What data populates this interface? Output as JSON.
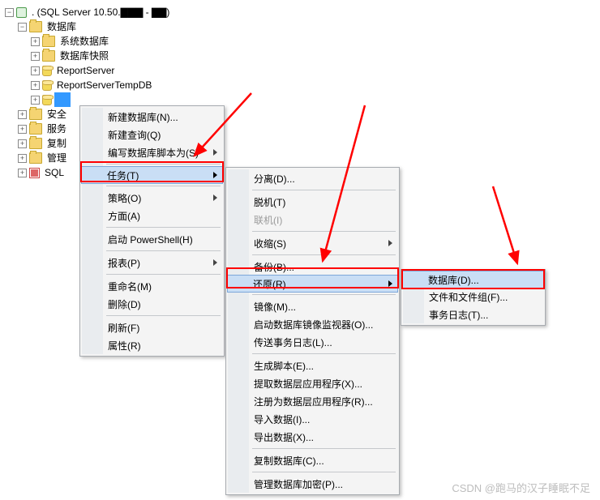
{
  "tree": {
    "server": ". (SQL Server 10.50.▇▇▇ - ▇▇)",
    "databases": "数据库",
    "items": [
      {
        "label": "系统数据库",
        "icon": "folder"
      },
      {
        "label": "数据库快照",
        "icon": "folder"
      },
      {
        "label": "ReportServer",
        "icon": "db"
      },
      {
        "label": "ReportServerTempDB",
        "icon": "db"
      },
      {
        "label": "",
        "icon": "db",
        "selected": true
      }
    ],
    "siblings": [
      {
        "label": "安全",
        "icon": "folder"
      },
      {
        "label": "服务",
        "icon": "folder"
      },
      {
        "label": "复制",
        "icon": "folder"
      },
      {
        "label": "管理",
        "icon": "folder"
      },
      {
        "label": "SQL",
        "icon": "red"
      }
    ]
  },
  "menu1": {
    "new_db": "新建数据库(N)...",
    "new_query": "新建查询(Q)",
    "script_as": "编写数据库脚本为(S)",
    "tasks": "任务(T)",
    "policies": "策略(O)",
    "facets": "方面(A)",
    "powershell": "启动 PowerShell(H)",
    "reports": "报表(P)",
    "rename": "重命名(M)",
    "delete": "删除(D)",
    "refresh": "刷新(F)",
    "properties": "属性(R)"
  },
  "menu2": {
    "detach": "分离(D)...",
    "offline": "脱机(T)",
    "online": "联机(I)",
    "shrink": "收缩(S)",
    "backup": "备份(B)...",
    "restore": "还原(R)",
    "mirror": "镜像(M)...",
    "launch_mirror": "启动数据库镜像监视器(O)...",
    "ship_log": "传送事务日志(L)...",
    "gen_scripts": "生成脚本(E)...",
    "extract_dac": "提取数据层应用程序(X)...",
    "register_dac": "注册为数据层应用程序(R)...",
    "import": "导入数据(I)...",
    "export": "导出数据(X)...",
    "copy_db": "复制数据库(C)...",
    "manage_enc": "管理数据库加密(P)..."
  },
  "menu3": {
    "database": "数据库(D)...",
    "files": "文件和文件组(F)...",
    "txlog": "事务日志(T)..."
  },
  "watermark": "CSDN @跑马的汉子睡眠不足"
}
